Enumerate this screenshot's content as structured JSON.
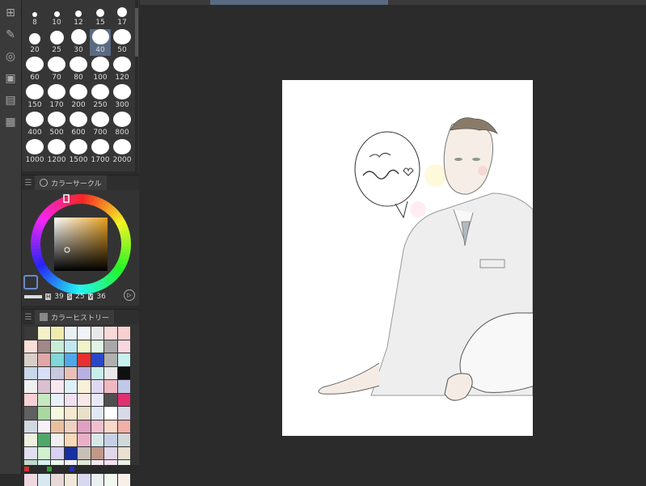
{
  "brush_sizes": [
    {
      "label": "8",
      "d": 6
    },
    {
      "label": "10",
      "d": 7
    },
    {
      "label": "12",
      "d": 8
    },
    {
      "label": "15",
      "d": 10
    },
    {
      "label": "17",
      "d": 12
    },
    {
      "label": "20",
      "d": 14
    },
    {
      "label": "25",
      "d": 17
    },
    {
      "label": "30",
      "d": 19
    },
    {
      "label": "40",
      "d": 21,
      "selected": true
    },
    {
      "label": "50",
      "d": 22
    },
    {
      "label": "60",
      "d": 22
    },
    {
      "label": "70",
      "d": 22
    },
    {
      "label": "80",
      "d": 22
    },
    {
      "label": "100",
      "d": 22
    },
    {
      "label": "120",
      "d": 22
    },
    {
      "label": "150",
      "d": 22
    },
    {
      "label": "170",
      "d": 22
    },
    {
      "label": "200",
      "d": 22
    },
    {
      "label": "250",
      "d": 22
    },
    {
      "label": "300",
      "d": 22
    },
    {
      "label": "400",
      "d": 22
    },
    {
      "label": "500",
      "d": 22
    },
    {
      "label": "600",
      "d": 22
    },
    {
      "label": "700",
      "d": 22
    },
    {
      "label": "800",
      "d": 22
    },
    {
      "label": "1000",
      "d": 22
    },
    {
      "label": "1200",
      "d": 22
    },
    {
      "label": "1500",
      "d": 22
    },
    {
      "label": "1700",
      "d": 22
    },
    {
      "label": "2000",
      "d": 22
    }
  ],
  "color_panel": {
    "title": "カラーサークル",
    "h_label": "H",
    "h_value": "39",
    "s_label": "S",
    "s_value": "25",
    "v_label": "V",
    "v_value": "36",
    "main_color": "#b48a3c"
  },
  "history_panel": {
    "title": "カラーヒストリー"
  },
  "history_swatches": [
    "#3a3a3a",
    "#f4f0c8",
    "#f0ecb0",
    "#e8f0f4",
    "#f0f4f8",
    "#e8e8e8",
    "#f8d8d8",
    "#f8d0d0",
    "#f8e0d8",
    "#a08888",
    "#c8ecd8",
    "#c0e8f0",
    "#f0f4c8",
    "#e0f4e8",
    "#a8a8a8",
    "#f8d8e0",
    "#d8d0c8",
    "#e0a8a8",
    "#80d8d8",
    "#50a8e8",
    "#e83030",
    "#2848c8",
    "#b0b0b0",
    "#c8f0f0",
    "#c8d8e8",
    "#d8e0f8",
    "#c8c8e0",
    "#e8c0b8",
    "#b8b0e0",
    "#c8f0e8",
    "#e8e8e8",
    "#101010",
    "#f0f0f0",
    "#d8c0d0",
    "#f8e8f0",
    "#e0f0f8",
    "#f8f0d8",
    "#e0d8f0",
    "#f0b8c0",
    "#c0c8e8",
    "#f8d0d8",
    "#c8e8c0",
    "#e8f0f8",
    "#f0e0f0",
    "#f8e8e8",
    "#e8e8f8",
    "#505050",
    "#e03070",
    "#606060",
    "#a8d8a0",
    "#f8f8e0",
    "#f8e8d0",
    "#e8e0c8",
    "#e0e8f8",
    "#ffffff",
    "#d8d8e8",
    "#d0d8e0",
    "#f8f0f8",
    "#e8c0a0",
    "#f0d0c0",
    "#e0a0c0",
    "#f0c0d0",
    "#f8d8c8",
    "#f0b0a8",
    "#f0f0e0",
    "#50a868",
    "#f0f0f0",
    "#f8d8b8",
    "#e8b0c8",
    "#d8e8e8",
    "#c8d0e8",
    "#d0d8d8",
    "#e0e0f0",
    "#d0f0d0",
    "#d8d0f0",
    "#1830a0",
    "#c8c0b8",
    "#c09888",
    "#e0d8e8",
    "#e8e0d0",
    "#c0d8c8",
    "#d8f0f0",
    "#e8f8f0",
    "#f0f0f8",
    "#e0e8d8",
    "#f8e8f8",
    "#f8e0f0",
    "#e8f0e8",
    "#f0d8e0",
    "#d8e8f0",
    "#e8d8d8",
    "#f0e8d8",
    "#d8d8f0",
    "#e8f0f0",
    "#f0f8f0",
    "#f8f0e8"
  ],
  "bottom_swatches": [
    "#d03030",
    "#30a030",
    "#2030c0"
  ],
  "tools": [
    "layer-tool",
    "pen-tool",
    "decoration-tool",
    "navigator-tool",
    "timeline-tool",
    "material-tool"
  ]
}
